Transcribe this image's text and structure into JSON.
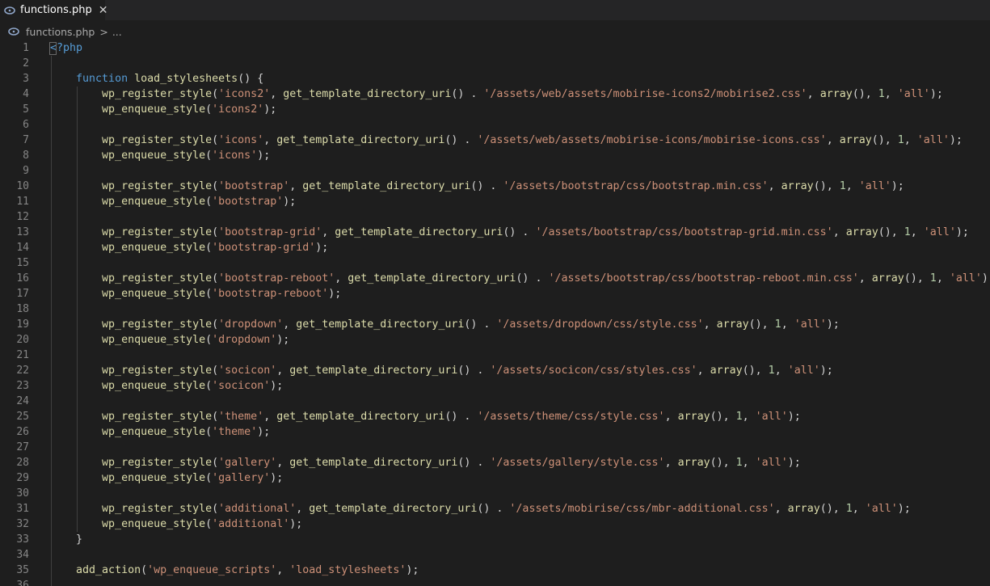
{
  "tab": {
    "filename": "functions.php",
    "icon": "php-elephant-icon",
    "close_symbol": "✕"
  },
  "breadcrumb": {
    "file": "functions.php",
    "separator": ">",
    "more": "..."
  },
  "colors": {
    "background": "#1e1e1e",
    "keyword": "#569cd6",
    "function": "#dcdcaa",
    "string": "#ce9178",
    "number": "#b5cea8",
    "line_number": "#858585",
    "default": "#d4d4d4"
  },
  "code_lines": [
    [
      [
        "tag",
        "<?php"
      ]
    ],
    [],
    [
      [
        "def",
        "    "
      ],
      [
        "kw",
        "function"
      ],
      [
        "def",
        " "
      ],
      [
        "fn",
        "load_stylesheets"
      ],
      [
        "def",
        "() {"
      ]
    ],
    [
      [
        "def",
        "        "
      ],
      [
        "fn",
        "wp_register_style"
      ],
      [
        "def",
        "("
      ],
      [
        "str",
        "'icons2'"
      ],
      [
        "def",
        ", "
      ],
      [
        "fn",
        "get_template_directory_uri"
      ],
      [
        "def",
        "() . "
      ],
      [
        "str",
        "'/assets/web/assets/mobirise-icons2/mobirise2.css'"
      ],
      [
        "def",
        ", "
      ],
      [
        "fn",
        "array"
      ],
      [
        "def",
        "(), "
      ],
      [
        "num",
        "1"
      ],
      [
        "def",
        ", "
      ],
      [
        "str",
        "'all'"
      ],
      [
        "def",
        ");"
      ]
    ],
    [
      [
        "def",
        "        "
      ],
      [
        "fn",
        "wp_enqueue_style"
      ],
      [
        "def",
        "("
      ],
      [
        "str",
        "'icons2'"
      ],
      [
        "def",
        ");"
      ]
    ],
    [],
    [
      [
        "def",
        "        "
      ],
      [
        "fn",
        "wp_register_style"
      ],
      [
        "def",
        "("
      ],
      [
        "str",
        "'icons'"
      ],
      [
        "def",
        ", "
      ],
      [
        "fn",
        "get_template_directory_uri"
      ],
      [
        "def",
        "() . "
      ],
      [
        "str",
        "'/assets/web/assets/mobirise-icons/mobirise-icons.css'"
      ],
      [
        "def",
        ", "
      ],
      [
        "fn",
        "array"
      ],
      [
        "def",
        "(), "
      ],
      [
        "num",
        "1"
      ],
      [
        "def",
        ", "
      ],
      [
        "str",
        "'all'"
      ],
      [
        "def",
        ");"
      ]
    ],
    [
      [
        "def",
        "        "
      ],
      [
        "fn",
        "wp_enqueue_style"
      ],
      [
        "def",
        "("
      ],
      [
        "str",
        "'icons'"
      ],
      [
        "def",
        ");"
      ]
    ],
    [],
    [
      [
        "def",
        "        "
      ],
      [
        "fn",
        "wp_register_style"
      ],
      [
        "def",
        "("
      ],
      [
        "str",
        "'bootstrap'"
      ],
      [
        "def",
        ", "
      ],
      [
        "fn",
        "get_template_directory_uri"
      ],
      [
        "def",
        "() . "
      ],
      [
        "str",
        "'/assets/bootstrap/css/bootstrap.min.css'"
      ],
      [
        "def",
        ", "
      ],
      [
        "fn",
        "array"
      ],
      [
        "def",
        "(), "
      ],
      [
        "num",
        "1"
      ],
      [
        "def",
        ", "
      ],
      [
        "str",
        "'all'"
      ],
      [
        "def",
        ");"
      ]
    ],
    [
      [
        "def",
        "        "
      ],
      [
        "fn",
        "wp_enqueue_style"
      ],
      [
        "def",
        "("
      ],
      [
        "str",
        "'bootstrap'"
      ],
      [
        "def",
        ");"
      ]
    ],
    [],
    [
      [
        "def",
        "        "
      ],
      [
        "fn",
        "wp_register_style"
      ],
      [
        "def",
        "("
      ],
      [
        "str",
        "'bootstrap-grid'"
      ],
      [
        "def",
        ", "
      ],
      [
        "fn",
        "get_template_directory_uri"
      ],
      [
        "def",
        "() . "
      ],
      [
        "str",
        "'/assets/bootstrap/css/bootstrap-grid.min.css'"
      ],
      [
        "def",
        ", "
      ],
      [
        "fn",
        "array"
      ],
      [
        "def",
        "(), "
      ],
      [
        "num",
        "1"
      ],
      [
        "def",
        ", "
      ],
      [
        "str",
        "'all'"
      ],
      [
        "def",
        ");"
      ]
    ],
    [
      [
        "def",
        "        "
      ],
      [
        "fn",
        "wp_enqueue_style"
      ],
      [
        "def",
        "("
      ],
      [
        "str",
        "'bootstrap-grid'"
      ],
      [
        "def",
        ");"
      ]
    ],
    [],
    [
      [
        "def",
        "        "
      ],
      [
        "fn",
        "wp_register_style"
      ],
      [
        "def",
        "("
      ],
      [
        "str",
        "'bootstrap-reboot'"
      ],
      [
        "def",
        ", "
      ],
      [
        "fn",
        "get_template_directory_uri"
      ],
      [
        "def",
        "() . "
      ],
      [
        "str",
        "'/assets/bootstrap/css/bootstrap-reboot.min.css'"
      ],
      [
        "def",
        ", "
      ],
      [
        "fn",
        "array"
      ],
      [
        "def",
        "(), "
      ],
      [
        "num",
        "1"
      ],
      [
        "def",
        ", "
      ],
      [
        "str",
        "'all'"
      ],
      [
        "def",
        ");"
      ]
    ],
    [
      [
        "def",
        "        "
      ],
      [
        "fn",
        "wp_enqueue_style"
      ],
      [
        "def",
        "("
      ],
      [
        "str",
        "'bootstrap-reboot'"
      ],
      [
        "def",
        ");"
      ]
    ],
    [],
    [
      [
        "def",
        "        "
      ],
      [
        "fn",
        "wp_register_style"
      ],
      [
        "def",
        "("
      ],
      [
        "str",
        "'dropdown'"
      ],
      [
        "def",
        ", "
      ],
      [
        "fn",
        "get_template_directory_uri"
      ],
      [
        "def",
        "() . "
      ],
      [
        "str",
        "'/assets/dropdown/css/style.css'"
      ],
      [
        "def",
        ", "
      ],
      [
        "fn",
        "array"
      ],
      [
        "def",
        "(), "
      ],
      [
        "num",
        "1"
      ],
      [
        "def",
        ", "
      ],
      [
        "str",
        "'all'"
      ],
      [
        "def",
        ");"
      ]
    ],
    [
      [
        "def",
        "        "
      ],
      [
        "fn",
        "wp_enqueue_style"
      ],
      [
        "def",
        "("
      ],
      [
        "str",
        "'dropdown'"
      ],
      [
        "def",
        ");"
      ]
    ],
    [],
    [
      [
        "def",
        "        "
      ],
      [
        "fn",
        "wp_register_style"
      ],
      [
        "def",
        "("
      ],
      [
        "str",
        "'socicon'"
      ],
      [
        "def",
        ", "
      ],
      [
        "fn",
        "get_template_directory_uri"
      ],
      [
        "def",
        "() . "
      ],
      [
        "str",
        "'/assets/socicon/css/styles.css'"
      ],
      [
        "def",
        ", "
      ],
      [
        "fn",
        "array"
      ],
      [
        "def",
        "(), "
      ],
      [
        "num",
        "1"
      ],
      [
        "def",
        ", "
      ],
      [
        "str",
        "'all'"
      ],
      [
        "def",
        ");"
      ]
    ],
    [
      [
        "def",
        "        "
      ],
      [
        "fn",
        "wp_enqueue_style"
      ],
      [
        "def",
        "("
      ],
      [
        "str",
        "'socicon'"
      ],
      [
        "def",
        ");"
      ]
    ],
    [],
    [
      [
        "def",
        "        "
      ],
      [
        "fn",
        "wp_register_style"
      ],
      [
        "def",
        "("
      ],
      [
        "str",
        "'theme'"
      ],
      [
        "def",
        ", "
      ],
      [
        "fn",
        "get_template_directory_uri"
      ],
      [
        "def",
        "() . "
      ],
      [
        "str",
        "'/assets/theme/css/style.css'"
      ],
      [
        "def",
        ", "
      ],
      [
        "fn",
        "array"
      ],
      [
        "def",
        "(), "
      ],
      [
        "num",
        "1"
      ],
      [
        "def",
        ", "
      ],
      [
        "str",
        "'all'"
      ],
      [
        "def",
        ");"
      ]
    ],
    [
      [
        "def",
        "        "
      ],
      [
        "fn",
        "wp_enqueue_style"
      ],
      [
        "def",
        "("
      ],
      [
        "str",
        "'theme'"
      ],
      [
        "def",
        ");"
      ]
    ],
    [],
    [
      [
        "def",
        "        "
      ],
      [
        "fn",
        "wp_register_style"
      ],
      [
        "def",
        "("
      ],
      [
        "str",
        "'gallery'"
      ],
      [
        "def",
        ", "
      ],
      [
        "fn",
        "get_template_directory_uri"
      ],
      [
        "def",
        "() . "
      ],
      [
        "str",
        "'/assets/gallery/style.css'"
      ],
      [
        "def",
        ", "
      ],
      [
        "fn",
        "array"
      ],
      [
        "def",
        "(), "
      ],
      [
        "num",
        "1"
      ],
      [
        "def",
        ", "
      ],
      [
        "str",
        "'all'"
      ],
      [
        "def",
        ");"
      ]
    ],
    [
      [
        "def",
        "        "
      ],
      [
        "fn",
        "wp_enqueue_style"
      ],
      [
        "def",
        "("
      ],
      [
        "str",
        "'gallery'"
      ],
      [
        "def",
        ");"
      ]
    ],
    [],
    [
      [
        "def",
        "        "
      ],
      [
        "fn",
        "wp_register_style"
      ],
      [
        "def",
        "("
      ],
      [
        "str",
        "'additional'"
      ],
      [
        "def",
        ", "
      ],
      [
        "fn",
        "get_template_directory_uri"
      ],
      [
        "def",
        "() . "
      ],
      [
        "str",
        "'/assets/mobirise/css/mbr-additional.css'"
      ],
      [
        "def",
        ", "
      ],
      [
        "fn",
        "array"
      ],
      [
        "def",
        "(), "
      ],
      [
        "num",
        "1"
      ],
      [
        "def",
        ", "
      ],
      [
        "str",
        "'all'"
      ],
      [
        "def",
        ");"
      ]
    ],
    [
      [
        "def",
        "        "
      ],
      [
        "fn",
        "wp_enqueue_style"
      ],
      [
        "def",
        "("
      ],
      [
        "str",
        "'additional'"
      ],
      [
        "def",
        ");"
      ]
    ],
    [
      [
        "def",
        "    }"
      ]
    ],
    [],
    [
      [
        "def",
        "    "
      ],
      [
        "fn",
        "add_action"
      ],
      [
        "def",
        "("
      ],
      [
        "str",
        "'wp_enqueue_scripts'"
      ],
      [
        "def",
        ", "
      ],
      [
        "str",
        "'load_stylesheets'"
      ],
      [
        "def",
        ");"
      ]
    ],
    []
  ]
}
